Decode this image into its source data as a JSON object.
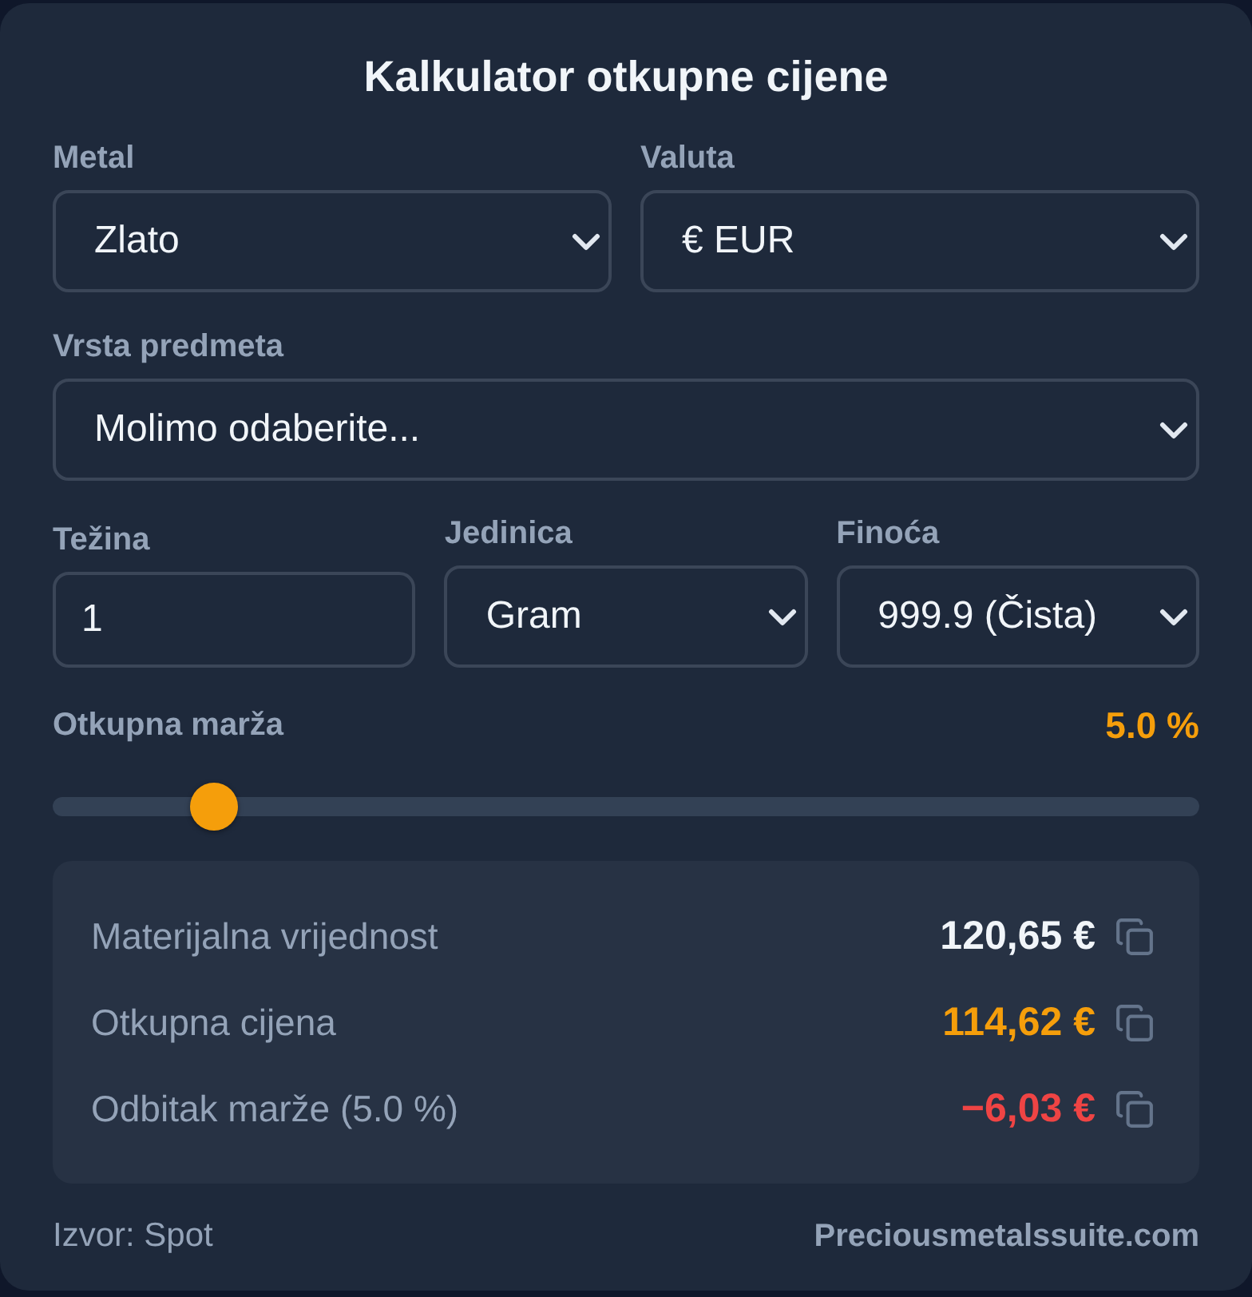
{
  "title": "Kalkulator otkupne cijene",
  "form_rows": [
    [
      {
        "label": "Metal",
        "kind": "select",
        "value": "Zlato"
      },
      {
        "label": "Valuta",
        "kind": "select",
        "value": "€ EUR"
      }
    ],
    [
      {
        "label": "Vrsta predmeta",
        "kind": "select",
        "value": "Molimo odaberite..."
      }
    ],
    [
      {
        "label": "Težina",
        "kind": "input",
        "value": "1"
      },
      {
        "label": "Jedinica",
        "kind": "select",
        "value": "Gram"
      },
      {
        "label": "Finoća",
        "kind": "select",
        "value": "999.9 (Čista)"
      }
    ]
  ],
  "margin": {
    "label": "Otkupna marža",
    "reading": "5.0 %",
    "level": 0.125
  },
  "results": [
    {
      "label": "Materijalna vrijednost",
      "value": "120,65 €",
      "color": "#f1f5f9"
    },
    {
      "label": "Otkupna cijena",
      "value": "114,62 €",
      "color": "#f59e0b"
    },
    {
      "label": "Odbitak marže (5.0 %)",
      "value": "−6,03 €",
      "color": "#ef4444"
    }
  ],
  "footer": {
    "source": "Izvor: Spot",
    "site": "Preciousmetalssuite.com"
  }
}
